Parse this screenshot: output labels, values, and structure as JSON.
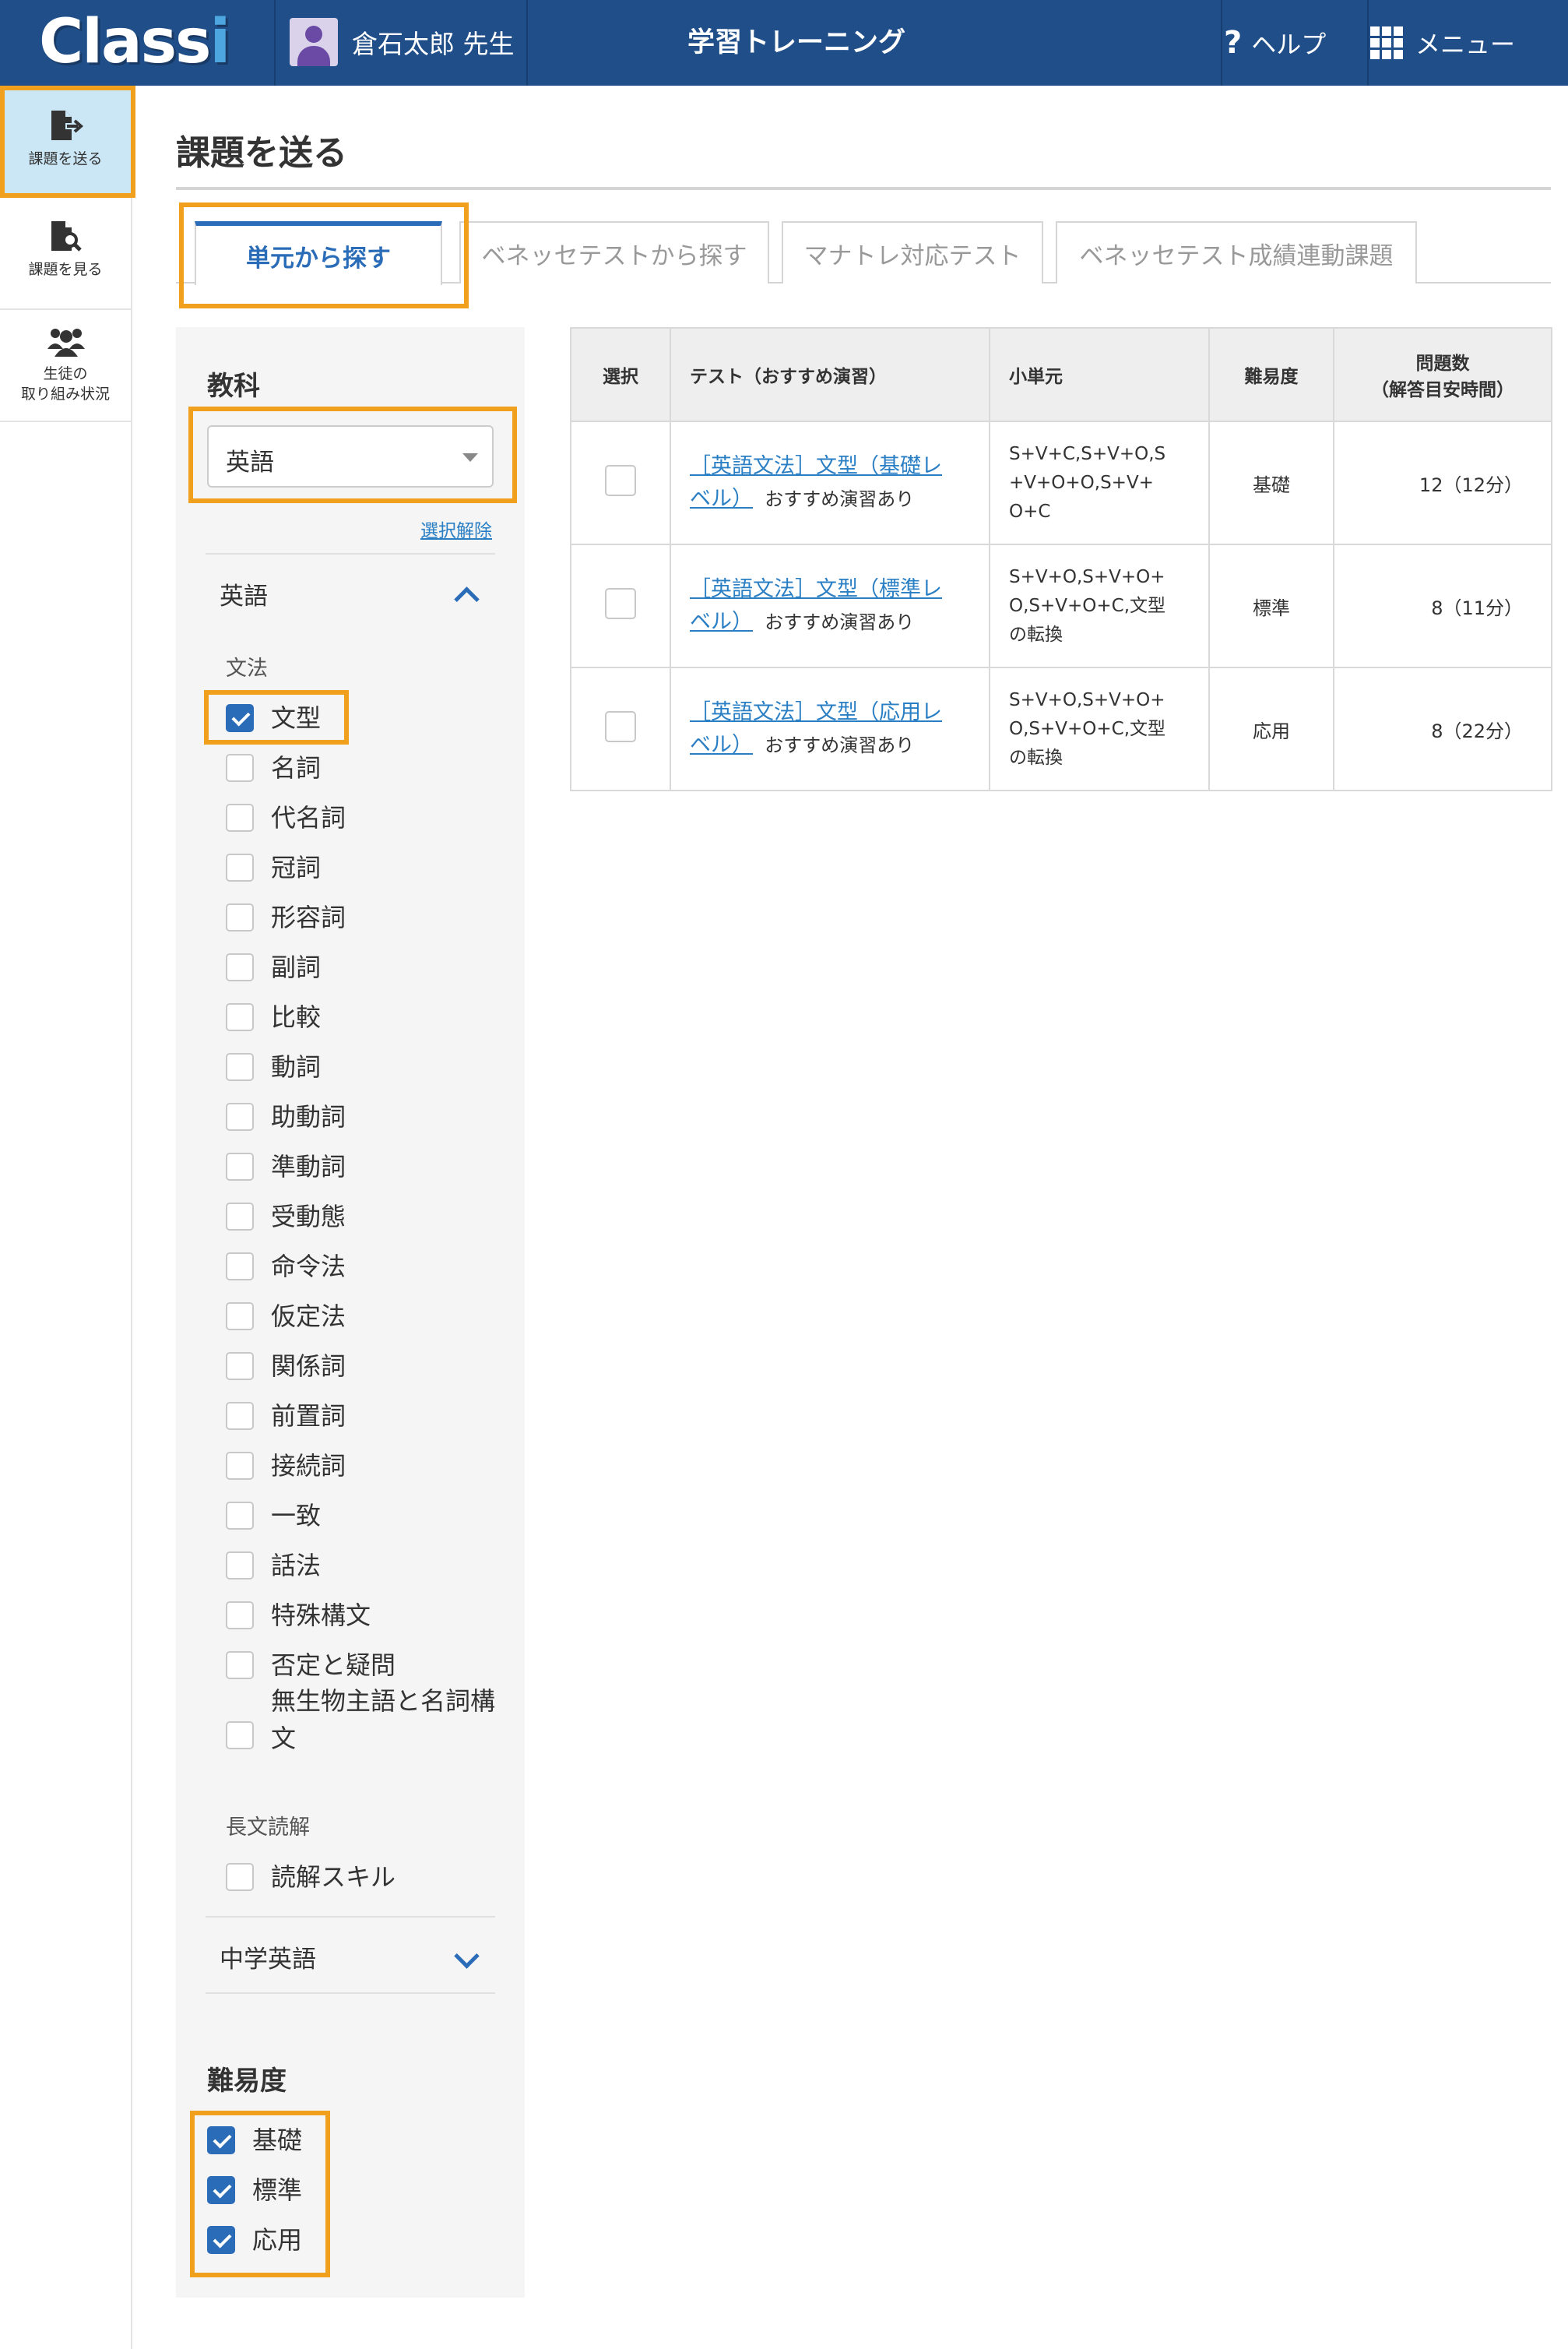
{
  "header": {
    "logo": "Classi",
    "user_name": "倉石太郎 先生",
    "app_title": "学習トレーニング",
    "help_label": "ヘルプ",
    "menu_label": "メニュー"
  },
  "leftnav": [
    {
      "label": "課題を送る",
      "icon": "send-assignment-icon",
      "active": true
    },
    {
      "label": "課題を見る",
      "icon": "view-assignment-icon",
      "active": false
    },
    {
      "label_line1": "生徒の",
      "label_line2": "取り組み状況",
      "icon": "students-icon",
      "active": false
    }
  ],
  "page": {
    "title": "課題を送る",
    "tabs": [
      "単元から探す",
      "ベネッセテストから探す",
      "マナトレ対応テスト",
      "ベネッセテスト成績連動課題"
    ],
    "active_tab": 0
  },
  "filter": {
    "subject_heading": "教科",
    "subject_value": "英語",
    "clear_label": "選択解除",
    "group1_label": "英語",
    "grammar_label": "文法",
    "grammar_items": [
      {
        "label": "文型",
        "checked": true
      },
      {
        "label": "名詞",
        "checked": false
      },
      {
        "label": "代名詞",
        "checked": false
      },
      {
        "label": "冠詞",
        "checked": false
      },
      {
        "label": "形容詞",
        "checked": false
      },
      {
        "label": "副詞",
        "checked": false
      },
      {
        "label": "比較",
        "checked": false
      },
      {
        "label": "動詞",
        "checked": false
      },
      {
        "label": "助動詞",
        "checked": false
      },
      {
        "label": "準動詞",
        "checked": false
      },
      {
        "label": "受動態",
        "checked": false
      },
      {
        "label": "命令法",
        "checked": false
      },
      {
        "label": "仮定法",
        "checked": false
      },
      {
        "label": "関係詞",
        "checked": false
      },
      {
        "label": "前置詞",
        "checked": false
      },
      {
        "label": "接続詞",
        "checked": false
      },
      {
        "label": "一致",
        "checked": false
      },
      {
        "label": "話法",
        "checked": false
      },
      {
        "label": "特殊構文",
        "checked": false
      },
      {
        "label": "否定と疑問",
        "checked": false
      },
      {
        "label": "無生物主語と名詞構文",
        "checked": false
      }
    ],
    "reading_label": "長文読解",
    "reading_items": [
      {
        "label": "読解スキル",
        "checked": false
      }
    ],
    "group2_label": "中学英語",
    "difficulty_heading": "難易度",
    "difficulty_items": [
      {
        "label": "基礎",
        "checked": true
      },
      {
        "label": "標準",
        "checked": true
      },
      {
        "label": "応用",
        "checked": true
      }
    ]
  },
  "table": {
    "headers": {
      "select": "選択",
      "test": "テスト（おすすめ演習）",
      "unit": "小単元",
      "difficulty": "難易度",
      "count_line1": "問題数",
      "count_line2": "（解答目安時間）"
    },
    "rows": [
      {
        "title_l1": "［英語文法］文型（基礎レ",
        "title_l2": "ベル）",
        "note": "おすすめ演習あり",
        "unit_l1": "S+V+C,S+V+O,S",
        "unit_l2": "+V+O+O,S+V+",
        "unit_l3": "O+C",
        "difficulty": "基礎",
        "count": "12（12分）"
      },
      {
        "title_l1": "［英語文法］文型（標準レ",
        "title_l2": "ベル）",
        "note": "おすすめ演習あり",
        "unit_l1": "S+V+O,S+V+O+",
        "unit_l2": "O,S+V+O+C,文型",
        "unit_l3": "の転換",
        "difficulty": "標準",
        "count": "8（11分）"
      },
      {
        "title_l1": "［英語文法］文型（応用レ",
        "title_l2": "ベル）",
        "note": "おすすめ演習あり",
        "unit_l1": "S+V+O,S+V+O+",
        "unit_l2": "O,S+V+O+C,文型",
        "unit_l3": "の転換",
        "difficulty": "応用",
        "count": "8（22分）"
      }
    ]
  },
  "colors": {
    "header_bg": "#1f4e89",
    "accent": "#2a6cb7",
    "highlight": "#f0a01d",
    "active_nav_bg": "#cbe7f6",
    "link": "#2a7fc4"
  }
}
